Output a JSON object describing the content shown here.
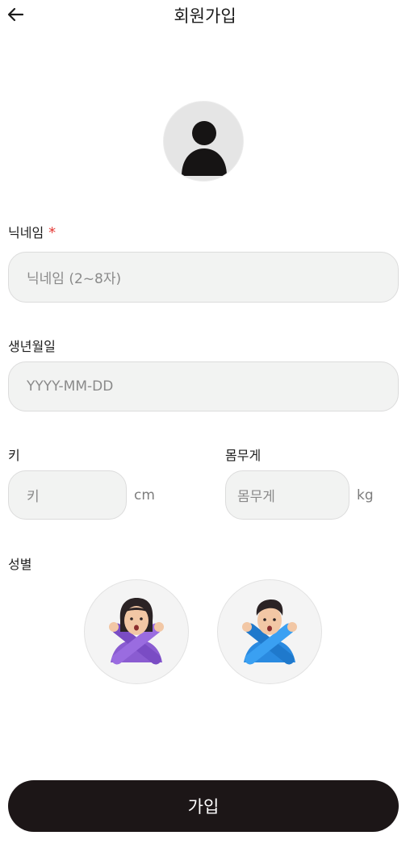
{
  "header": {
    "title": "회원가입",
    "back_icon": "arrow-left-icon"
  },
  "profile": {
    "avatar_icon": "user-placeholder-icon"
  },
  "nickname": {
    "label": "닉네임",
    "required_mark": "*",
    "placeholder": "닉네임 (2~8자)"
  },
  "birthdate": {
    "label": "생년월일",
    "placeholder": "YYYY-MM-DD"
  },
  "height": {
    "label": "키",
    "placeholder": "키",
    "unit": "cm"
  },
  "weight": {
    "label": "몸무게",
    "placeholder": "몸무게",
    "unit": "kg"
  },
  "gender": {
    "label": "성별",
    "options": [
      {
        "name": "female",
        "icon": "woman-gesturing-no-icon",
        "color": "#8a5cd1"
      },
      {
        "name": "male",
        "icon": "man-gesturing-no-icon",
        "color": "#2a8ae0"
      }
    ]
  },
  "submit": {
    "label": "가입"
  },
  "colors": {
    "primary": "#1c1617",
    "required": "#e53935",
    "field_bg": "#f2f3f2"
  }
}
